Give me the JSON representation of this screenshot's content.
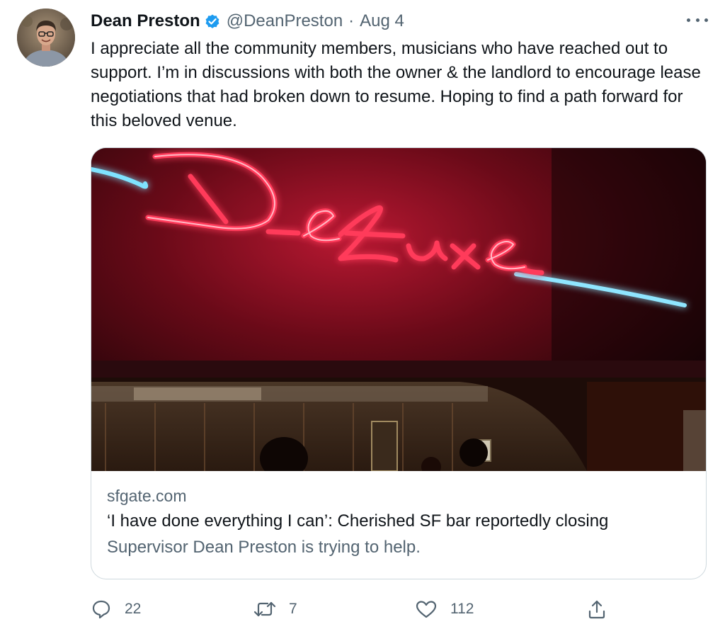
{
  "author": {
    "name": "Dean Preston",
    "handle": "@DeanPreston",
    "separator": "·",
    "date": "Aug 4"
  },
  "tweet": {
    "text": "I appreciate all the community members, musicians who have reached out to support. I’m in discussions with both the owner & the landlord to encourage lease negotiations that had broken down to resume. Hoping to find a path forward for this beloved venue."
  },
  "card": {
    "domain": "sfgate.com",
    "title": "‘I have done everything I can’: Cherished SF bar reportedly closing",
    "description": "Supervisor Dean Preston is trying to help.",
    "sign_text": "DeLuxe"
  },
  "actions": {
    "replies": "22",
    "retweets": "7",
    "likes": "112"
  },
  "colors": {
    "verified": "#1d9bf0",
    "secondary_text": "#536471",
    "primary_text": "#0f1419",
    "border": "#cfd9de",
    "neon_red": "#ff2a4a",
    "neon_blue": "#7fe3ff"
  },
  "icons": {
    "reply": "speech-bubble-icon",
    "retweet": "retweet-arrows-icon",
    "like": "heart-icon",
    "share": "share-upload-icon",
    "verified": "verified-badge-icon",
    "more": "ellipsis-icon"
  }
}
